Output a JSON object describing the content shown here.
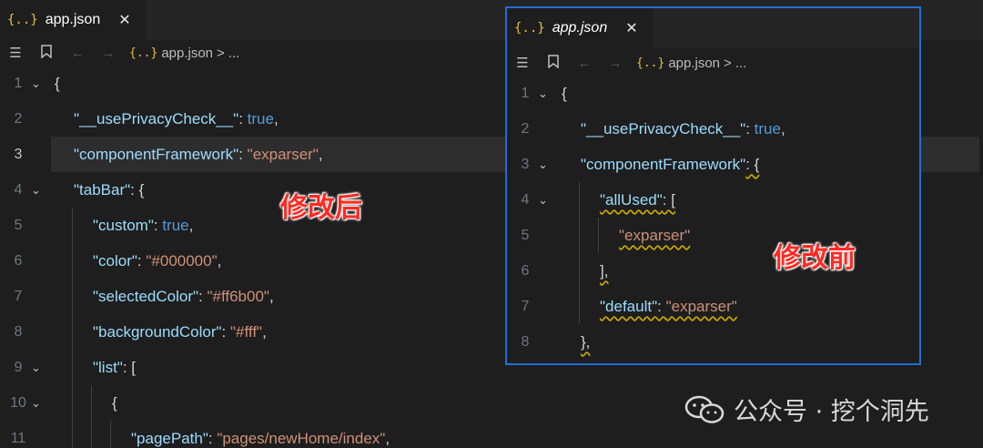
{
  "watermark": {
    "text": "公众号 · 挖个洞先"
  },
  "left_editor": {
    "tab": {
      "icon": "{..}",
      "title": "app.json",
      "close": "✕"
    },
    "breadcrumb": {
      "file_icon": "{..}",
      "file": "app.json",
      "separator": ">",
      "ellipsis": "..."
    },
    "annotation": "修改后",
    "lines": [
      {
        "n": "1",
        "fold": "open",
        "indent": 0,
        "tokens": [
          {
            "t": "{",
            "c": "p"
          }
        ]
      },
      {
        "n": "2",
        "indent": 1,
        "tokens": [
          {
            "t": "\"__usePrivacyCheck__\"",
            "c": "k"
          },
          {
            "t": ": ",
            "c": "p"
          },
          {
            "t": "true",
            "c": "kw"
          },
          {
            "t": ",",
            "c": "p"
          }
        ]
      },
      {
        "n": "3",
        "active": true,
        "indent": 1,
        "tokens": [
          {
            "t": "\"componentFramework\"",
            "c": "k"
          },
          {
            "t": ": ",
            "c": "p"
          },
          {
            "t": "\"exparser\"",
            "c": "s"
          },
          {
            "t": ",",
            "c": "p"
          }
        ]
      },
      {
        "n": "4",
        "fold": "open",
        "indent": 1,
        "tokens": [
          {
            "t": "\"tabBar\"",
            "c": "k"
          },
          {
            "t": ": {",
            "c": "p"
          }
        ]
      },
      {
        "n": "5",
        "indent": 2,
        "tokens": [
          {
            "t": "\"custom\"",
            "c": "k"
          },
          {
            "t": ": ",
            "c": "p"
          },
          {
            "t": "true",
            "c": "kw"
          },
          {
            "t": ",",
            "c": "p"
          }
        ]
      },
      {
        "n": "6",
        "indent": 2,
        "tokens": [
          {
            "t": "\"color\"",
            "c": "k"
          },
          {
            "t": ": ",
            "c": "p"
          },
          {
            "t": "\"#000000\"",
            "c": "s"
          },
          {
            "t": ",",
            "c": "p"
          }
        ]
      },
      {
        "n": "7",
        "indent": 2,
        "tokens": [
          {
            "t": "\"selectedColor\"",
            "c": "k"
          },
          {
            "t": ": ",
            "c": "p"
          },
          {
            "t": "\"#ff6b00\"",
            "c": "s"
          },
          {
            "t": ",",
            "c": "p"
          }
        ]
      },
      {
        "n": "8",
        "indent": 2,
        "tokens": [
          {
            "t": "\"backgroundColor\"",
            "c": "k"
          },
          {
            "t": ": ",
            "c": "p"
          },
          {
            "t": "\"#fff\"",
            "c": "s"
          },
          {
            "t": ",",
            "c": "p"
          }
        ]
      },
      {
        "n": "9",
        "fold": "open",
        "indent": 2,
        "tokens": [
          {
            "t": "\"list\"",
            "c": "k"
          },
          {
            "t": ": [",
            "c": "p"
          }
        ]
      },
      {
        "n": "10",
        "fold": "open",
        "indent": 3,
        "tokens": [
          {
            "t": "{",
            "c": "p"
          }
        ]
      },
      {
        "n": "11",
        "indent": 4,
        "tokens": [
          {
            "t": "\"pagePath\"",
            "c": "k"
          },
          {
            "t": ": ",
            "c": "p"
          },
          {
            "t": "\"pages/newHome/index\"",
            "c": "s"
          },
          {
            "t": ",",
            "c": "p"
          }
        ]
      }
    ]
  },
  "right_editor": {
    "tab": {
      "icon": "{..}",
      "title": "app.json",
      "close": "✕"
    },
    "breadcrumb": {
      "file_icon": "{..}",
      "file": "app.json",
      "separator": ">",
      "ellipsis": "..."
    },
    "annotation": "修改前",
    "lines": [
      {
        "n": "1",
        "fold": "open",
        "indent": 0,
        "tokens": [
          {
            "t": "{",
            "c": "p"
          }
        ]
      },
      {
        "n": "2",
        "indent": 1,
        "tokens": [
          {
            "t": "\"__usePrivacyCheck__\"",
            "c": "k"
          },
          {
            "t": ": ",
            "c": "p"
          },
          {
            "t": "true",
            "c": "kw"
          },
          {
            "t": ",",
            "c": "p"
          }
        ]
      },
      {
        "n": "3",
        "fold": "open",
        "indent": 1,
        "tokens": [
          {
            "t": "\"componentFramework\"",
            "c": "k"
          },
          {
            "t": ": {",
            "c": "p",
            "sq": true
          }
        ]
      },
      {
        "n": "4",
        "fold": "open",
        "indent": 2,
        "tokens": [
          {
            "t": "\"allUsed\"",
            "c": "k",
            "sq": true
          },
          {
            "t": ": [",
            "c": "p",
            "sq": true
          }
        ]
      },
      {
        "n": "5",
        "indent": 3,
        "tokens": [
          {
            "t": "\"exparser\"",
            "c": "s",
            "sq": true
          }
        ]
      },
      {
        "n": "6",
        "indent": 2,
        "tokens": [
          {
            "t": "],",
            "c": "p",
            "sq": true
          }
        ]
      },
      {
        "n": "7",
        "indent": 2,
        "tokens": [
          {
            "t": "\"default\"",
            "c": "k",
            "sq": true
          },
          {
            "t": ": ",
            "c": "p",
            "sq": true
          },
          {
            "t": "\"exparser\"",
            "c": "s",
            "sq": true
          }
        ]
      },
      {
        "n": "8",
        "indent": 1,
        "tokens": [
          {
            "t": "},",
            "c": "p",
            "sq": true
          }
        ]
      }
    ]
  }
}
